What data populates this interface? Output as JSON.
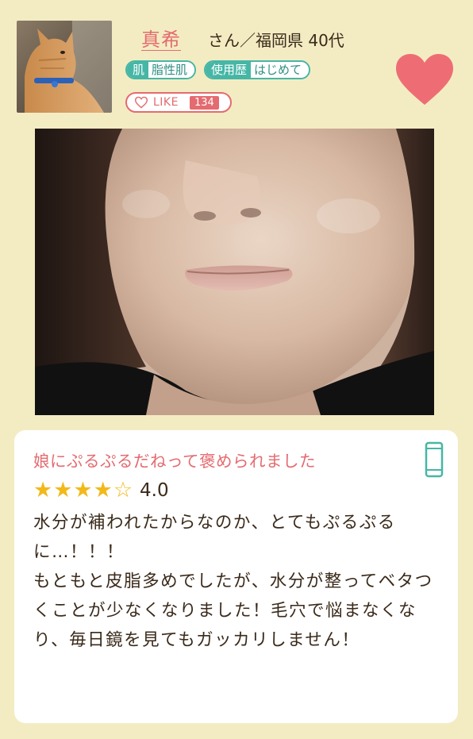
{
  "user": {
    "name": "真希",
    "meta": "さん／福岡県 40代",
    "tags": [
      {
        "key": "肌",
        "value": "脂性肌"
      },
      {
        "key": "使用歴",
        "value": "はじめて"
      }
    ],
    "like_label": "LIKE",
    "like_count": "134"
  },
  "review": {
    "title": "娘にぷるぷるだねって褒められました",
    "stars": "★★★★☆",
    "rating": "4.0",
    "body": "水分が補われたからなのか、とてもぷるぷるに…！！！\nもともと皮脂多めでしたが、水分が整ってベタつくことが少なくなりました！毛穴で悩まなくなり、毎日鏡を見てもガッカリしません！",
    "device_icon": "smartphone-icon"
  },
  "icons": {
    "favorite": "heart-icon",
    "like": "heart-outline-icon"
  },
  "colors": {
    "background": "#f3ecc3",
    "accent_pink": "#e46b70",
    "accent_teal": "#46b6a6",
    "star": "#f2b91a",
    "text": "#3a2a1a"
  }
}
